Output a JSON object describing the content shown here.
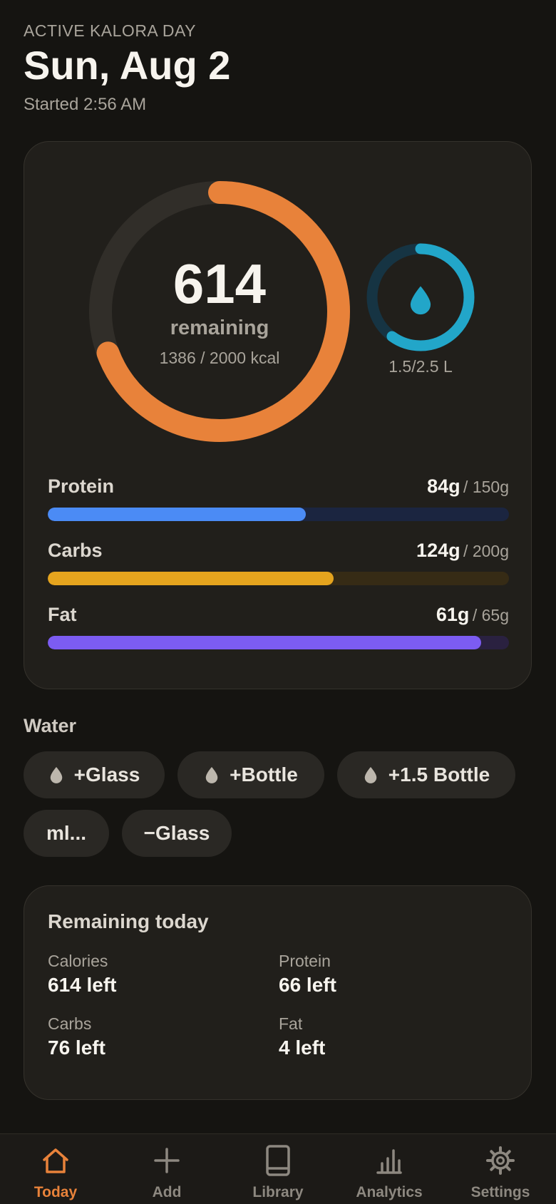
{
  "header": {
    "eyebrow": "ACTIVE KALORA DAY",
    "date": "Sun, Aug 2",
    "started": "Started 2:56 AM"
  },
  "calories": {
    "remaining": "614",
    "remaining_label": "remaining",
    "summary": "1386 / 2000 kcal",
    "consumed": 1386,
    "goal": 2000,
    "color": "#E8823A"
  },
  "water_ring": {
    "text": "1.5/2.5 L",
    "consumed": 1.5,
    "goal": 2.5,
    "color": "#22A6C9",
    "icon": "water-drop-icon"
  },
  "macros": [
    {
      "name": "Protein",
      "value": "84g",
      "goal": "/ 150g",
      "fraction": 0.56,
      "color": "#4B8BF5",
      "track": "#1B2540"
    },
    {
      "name": "Carbs",
      "value": "124g",
      "goal": "/ 200g",
      "fraction": 0.62,
      "color": "#E5A41E",
      "track": "#362B15"
    },
    {
      "name": "Fat",
      "value": "61g",
      "goal": "/ 65g",
      "fraction": 0.94,
      "color": "#7C5CF2",
      "track": "#2A2140"
    }
  ],
  "water": {
    "title": "Water",
    "chips": [
      "+Glass",
      "+Bottle",
      "+1.5 Bottle",
      "ml...",
      "−Glass"
    ]
  },
  "remaining_today": {
    "title": "Remaining today",
    "items": [
      {
        "label": "Calories",
        "value": "614 left"
      },
      {
        "label": "Protein",
        "value": "66 left"
      },
      {
        "label": "Carbs",
        "value": "76 left"
      },
      {
        "label": "Fat",
        "value": "4 left"
      }
    ]
  },
  "tabs": [
    {
      "label": "Today",
      "icon": "home-icon",
      "active": true
    },
    {
      "label": "Add",
      "icon": "plus-icon",
      "active": false
    },
    {
      "label": "Library",
      "icon": "book-icon",
      "active": false
    },
    {
      "label": "Analytics",
      "icon": "bar-chart-icon",
      "active": false
    },
    {
      "label": "Settings",
      "icon": "gear-icon",
      "active": false
    }
  ],
  "colors": {
    "accent": "#E8823A",
    "background": "#151411",
    "card": "#211F1B"
  }
}
